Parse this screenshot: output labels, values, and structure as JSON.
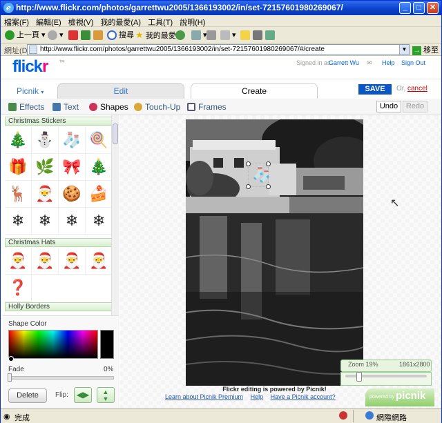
{
  "browser": {
    "title": "http://www.flickr.com/photos/garrettwu2005/1366193002/in/set-72157601980269067/",
    "menu": [
      "檔案(F)",
      "編輯(E)",
      "檢視(V)",
      "我的最愛(A)",
      "工具(T)",
      "說明(H)"
    ],
    "toolbar": {
      "back": "上一頁",
      "search": "搜尋",
      "favorites": "我的最愛"
    },
    "address_label": "網址(D)",
    "address": "http://www.flickr.com/photos/garrettwu2005/1366193002/in/set-72157601980269067/#/create",
    "go": "移至",
    "status_left": "完成",
    "status_right": "網際網路"
  },
  "flickr": {
    "logo_main": "flickr",
    "logo_suffix": "™",
    "signed_in_prefix": "Signed in as",
    "user": "Garrett Wu",
    "help": "Help",
    "sign_out": "Sign Out"
  },
  "tabs": {
    "picnik": "Picnik",
    "edit": "Edit",
    "create": "Create",
    "save": "SAVE",
    "or": "Or,",
    "cancel": "cancel"
  },
  "subtabs": {
    "effects": "Effects",
    "text": "Text",
    "shapes": "Shapes",
    "touchup": "Touch-Up",
    "frames": "Frames",
    "undo": "Undo",
    "redo": "Redo"
  },
  "sidebar": {
    "section1": "Christmas Stickers",
    "stickers": [
      "🎄",
      "⛄",
      "🧦",
      "🍭",
      "🎁",
      "🌿",
      "🎀",
      "🎄",
      "🦌",
      "🎅",
      "🍪",
      "🍰",
      "❄",
      "❄",
      "❄",
      "❄"
    ],
    "section2": "Christmas Hats",
    "hats": [
      "🎅",
      "🎅",
      "🎅",
      "🎅",
      "❓"
    ],
    "section3": "Holly Borders",
    "shape_color": "Shape Color",
    "fade": "Fade",
    "fade_value": "0%",
    "delete": "Delete",
    "flip": "Flip:"
  },
  "canvas": {
    "powered_text": "Flickr editing is powered by Picnik!",
    "learn": "Learn about Picnik Premium",
    "help": "Help",
    "account": "Have a Picnik account?",
    "zoom": "Zoom 19%",
    "dims": "1861x2800",
    "powered_by": "powered by",
    "picnik": "picnik"
  },
  "colors": {
    "flickr_blue": "#0063dc",
    "flickr_pink": "#ff0084",
    "save_blue": "#0b55c4",
    "link": "#2255aa"
  }
}
